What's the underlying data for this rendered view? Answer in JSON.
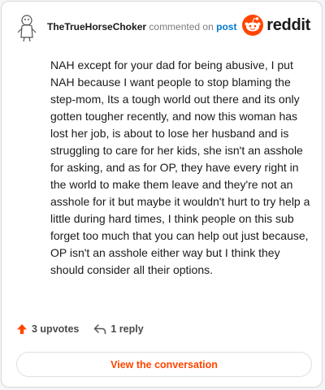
{
  "comment": {
    "author": "TheTrueHorseChoker",
    "action_text": "commented on",
    "post_link": "post",
    "body": "NAH except for your dad for being abusive, I put NAH because I want people to stop blaming the step-mom, Its a tough world out there and its only gotten tougher recently, and now this woman has lost her job, is about to lose her husband and is struggling to care for her kids, she isn't an asshole for asking, and as for OP, they have every right in the world to make them leave and they're not an asshole for it but maybe it wouldn't hurt to try help a little during hard times, I think people on this sub forget too much that you can help out just because, OP isn't an asshole either way but I think they should consider all their options."
  },
  "brand": {
    "wordmark": "reddit",
    "icon": "reddit-alien-icon",
    "color": "#ff4500"
  },
  "footer": {
    "upvotes": "3 upvotes",
    "replies": "1 reply",
    "upvote_icon": "upvote-arrow-icon",
    "reply_icon": "reply-arrow-icon",
    "upvote_color": "#ff4500"
  },
  "cta": {
    "label": "View the conversation"
  }
}
